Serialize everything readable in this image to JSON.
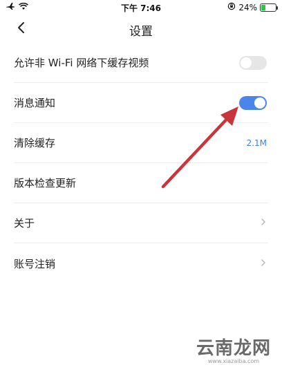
{
  "status_bar": {
    "time": "下午 7:46",
    "battery": "24%"
  },
  "nav": {
    "title": "设置"
  },
  "settings": {
    "items": [
      {
        "label": "允许非 Wi-Fi 网络下缓存视频",
        "control": "toggle",
        "on": false
      },
      {
        "label": "消息通知",
        "control": "toggle",
        "on": true
      },
      {
        "label": "清除缓存",
        "control": "value",
        "value": "2.1M"
      },
      {
        "label": "版本检查更新",
        "control": "none"
      },
      {
        "label": "关于",
        "control": "chevron"
      },
      {
        "label": "账号注销",
        "control": "chevron"
      }
    ]
  },
  "colors": {
    "accent": "#4a86ea",
    "toggle_off": "#e6e6e6",
    "value_text": "#3f7fe8",
    "annotation_arrow": "#c9353a"
  },
  "icons": [
    "airplane-icon",
    "wifi-icon",
    "back-chevron-icon",
    "lock-rotation-icon",
    "battery-icon",
    "chevron-right-icon"
  ],
  "watermark": {
    "brand": "云南龙网",
    "url": "www.xiazaiba.com"
  }
}
